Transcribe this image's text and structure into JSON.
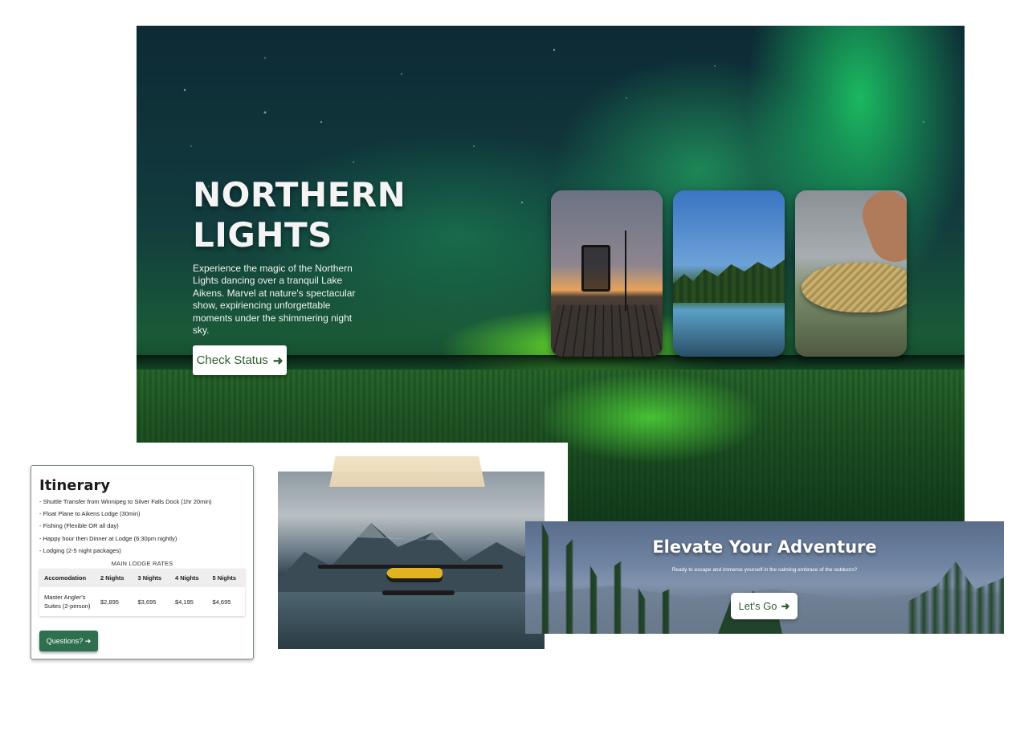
{
  "hero": {
    "title": "NORTHERN LIGHTS",
    "description": "Experience the magic of the Northern Lights dancing over a tranquil Lake Aikens. Marvel at nature's spectacular show, expiriencing unforgettable moments under the shimmering night sky.",
    "cta_label": "Check Status",
    "cta_icon": "arrow-right-icon",
    "photos": [
      "dock-chair-sunset-photo",
      "forest-lake-photo",
      "fish-catch-photo"
    ]
  },
  "itinerary": {
    "title": "Itinerary",
    "items": [
      "- Shuttle Transfer from Winnipeg to Silver Falls Dock (1hr 20min)",
      "- Float Plane to Aikens Lodge (30min)",
      "- Fishing (Flexible OR all day)",
      "- Happy hour then Dinner at Lodge (6:30pm nightly)",
      "- Lodging (2-5 night packages)"
    ],
    "rates_caption": "MAIN LODGE RATES",
    "headers": [
      "Accomodation",
      "2 Nights",
      "3 Nights",
      "4 Nights",
      "5 Nights"
    ],
    "rows": [
      [
        "Master Angler's Suites (2-person)",
        "$2,895",
        "$3,695",
        "$4,195",
        "$4,695"
      ]
    ],
    "button_label": "Questions?",
    "button_icon": "arrow-right-icon",
    "accent_color": "#2e6f4f"
  },
  "banner": {
    "title": "Elevate Your Adventure",
    "subtitle": "Ready to escape and immerse yourself in the calming embrace of the outdoors?",
    "cta_label": "Let's Go",
    "cta_icon": "arrow-right-icon"
  }
}
